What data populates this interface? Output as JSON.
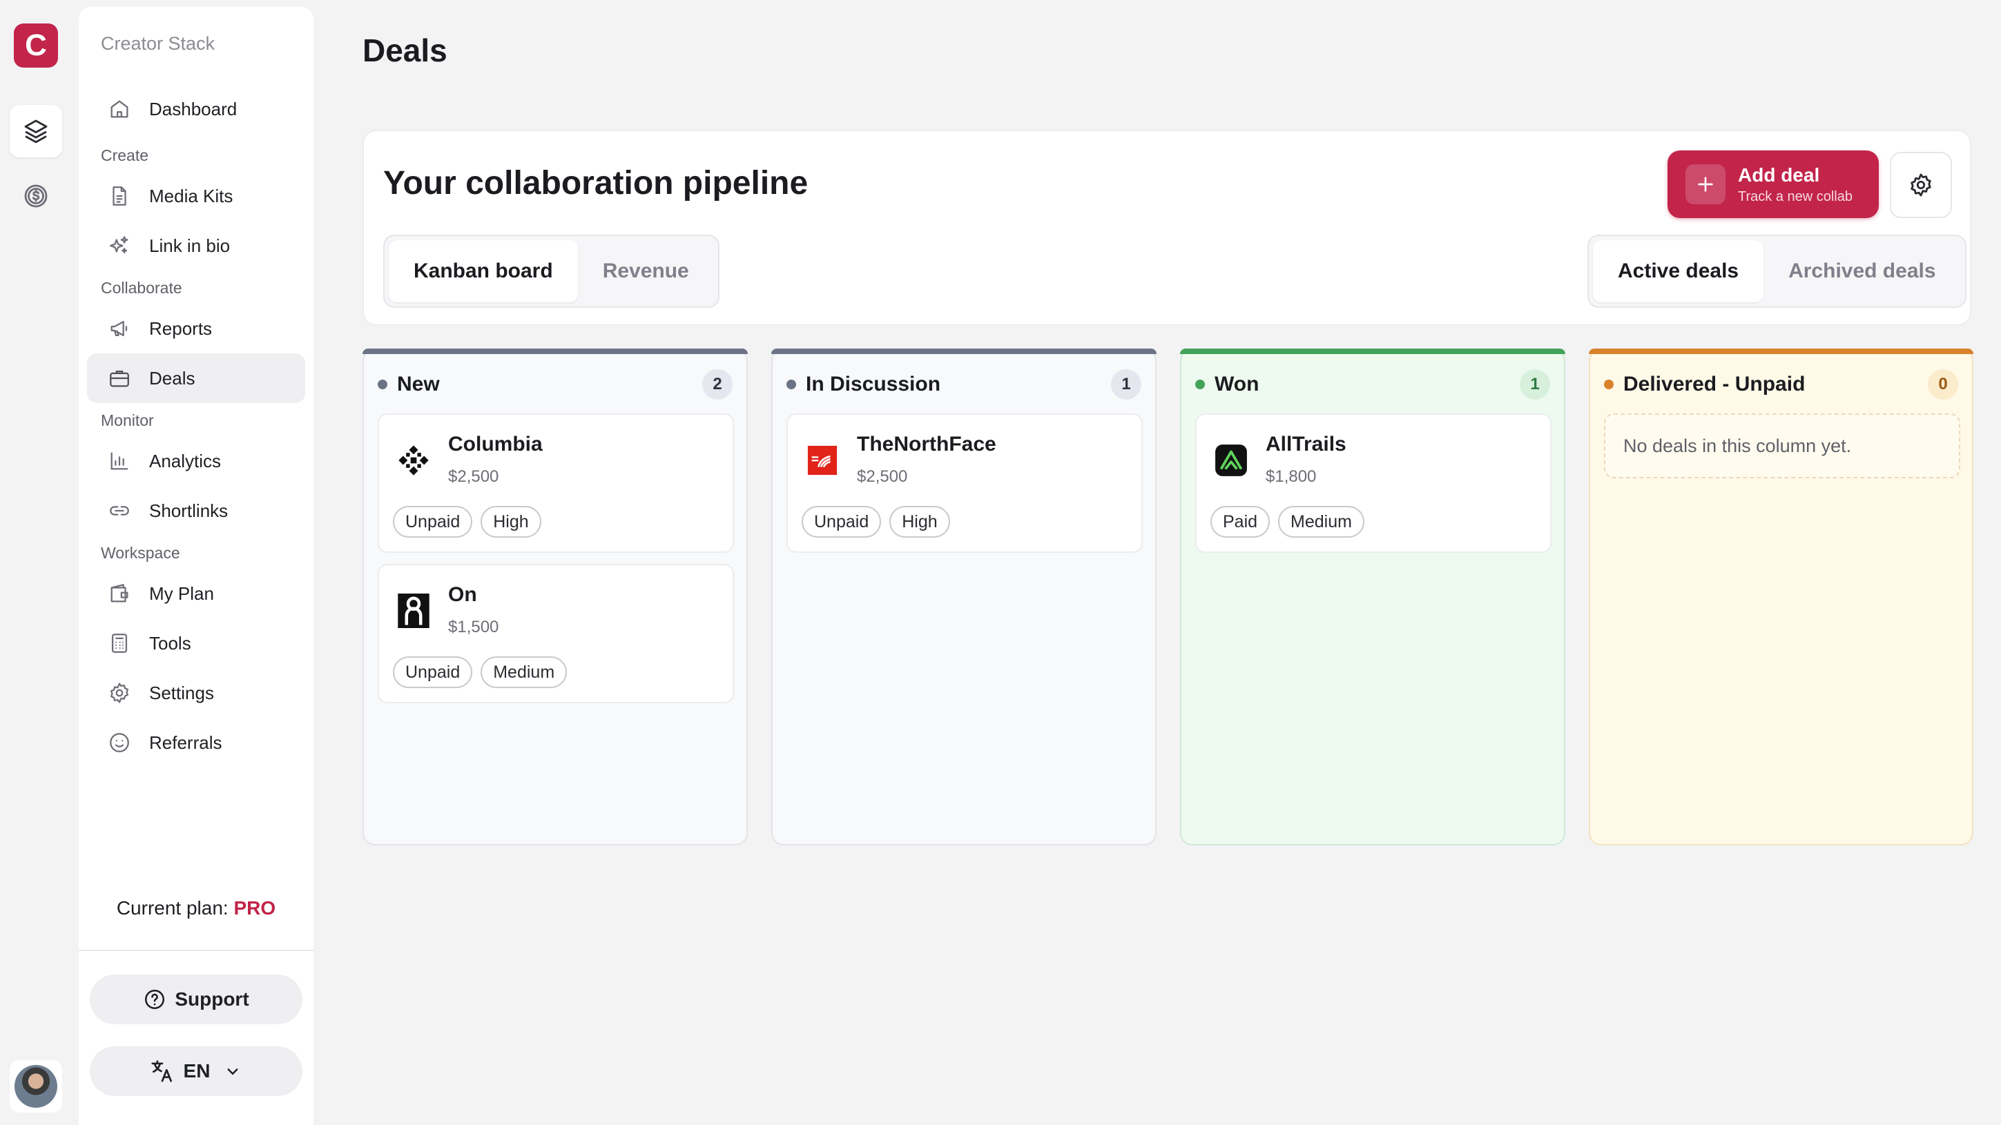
{
  "app": {
    "logo_letter": "C",
    "brand": "Creator Stack"
  },
  "sidebar": {
    "dashboard": "Dashboard",
    "sections": {
      "create": "Create",
      "collaborate": "Collaborate",
      "monitor": "Monitor",
      "workspace": "Workspace"
    },
    "items": {
      "media_kits": "Media Kits",
      "link_in_bio": "Link in bio",
      "reports": "Reports",
      "deals": "Deals",
      "analytics": "Analytics",
      "shortlinks": "Shortlinks",
      "my_plan": "My Plan",
      "tools": "Tools",
      "settings": "Settings",
      "referrals": "Referrals"
    },
    "current_plan_label": "Current plan:",
    "current_plan_value": "PRO",
    "support": "Support",
    "language": "EN"
  },
  "page": {
    "title": "Deals",
    "section_title": "Your collaboration pipeline",
    "view_tabs": [
      "Kanban board",
      "Revenue"
    ],
    "filter_tabs": [
      "Active deals",
      "Archived deals"
    ],
    "add_deal": {
      "label": "Add deal",
      "sublabel": "Track a new collab"
    }
  },
  "columns": [
    {
      "title": "New",
      "count": "2",
      "color": "#6b7385",
      "deals": [
        {
          "name": "Columbia",
          "amount": "$2,500",
          "tags": [
            "Unpaid",
            "High"
          ],
          "logo": "columbia-logo-icon"
        },
        {
          "name": "On",
          "amount": "$1,500",
          "tags": [
            "Unpaid",
            "Medium"
          ],
          "logo": "on-logo-icon"
        }
      ]
    },
    {
      "title": "In Discussion",
      "count": "1",
      "color": "#6b7385",
      "deals": [
        {
          "name": "TheNorthFace",
          "amount": "$2,500",
          "tags": [
            "Unpaid",
            "High"
          ],
          "logo": "northface-logo-icon"
        }
      ]
    },
    {
      "title": "Won",
      "count": "1",
      "color": "#43a35a",
      "deals": [
        {
          "name": "AllTrails",
          "amount": "$1,800",
          "tags": [
            "Paid",
            "Medium"
          ],
          "logo": "alltrails-logo-icon"
        }
      ]
    },
    {
      "title": "Delivered - Unpaid",
      "count": "0",
      "color": "#d9822b",
      "empty_text": "No deals in this column yet."
    }
  ]
}
